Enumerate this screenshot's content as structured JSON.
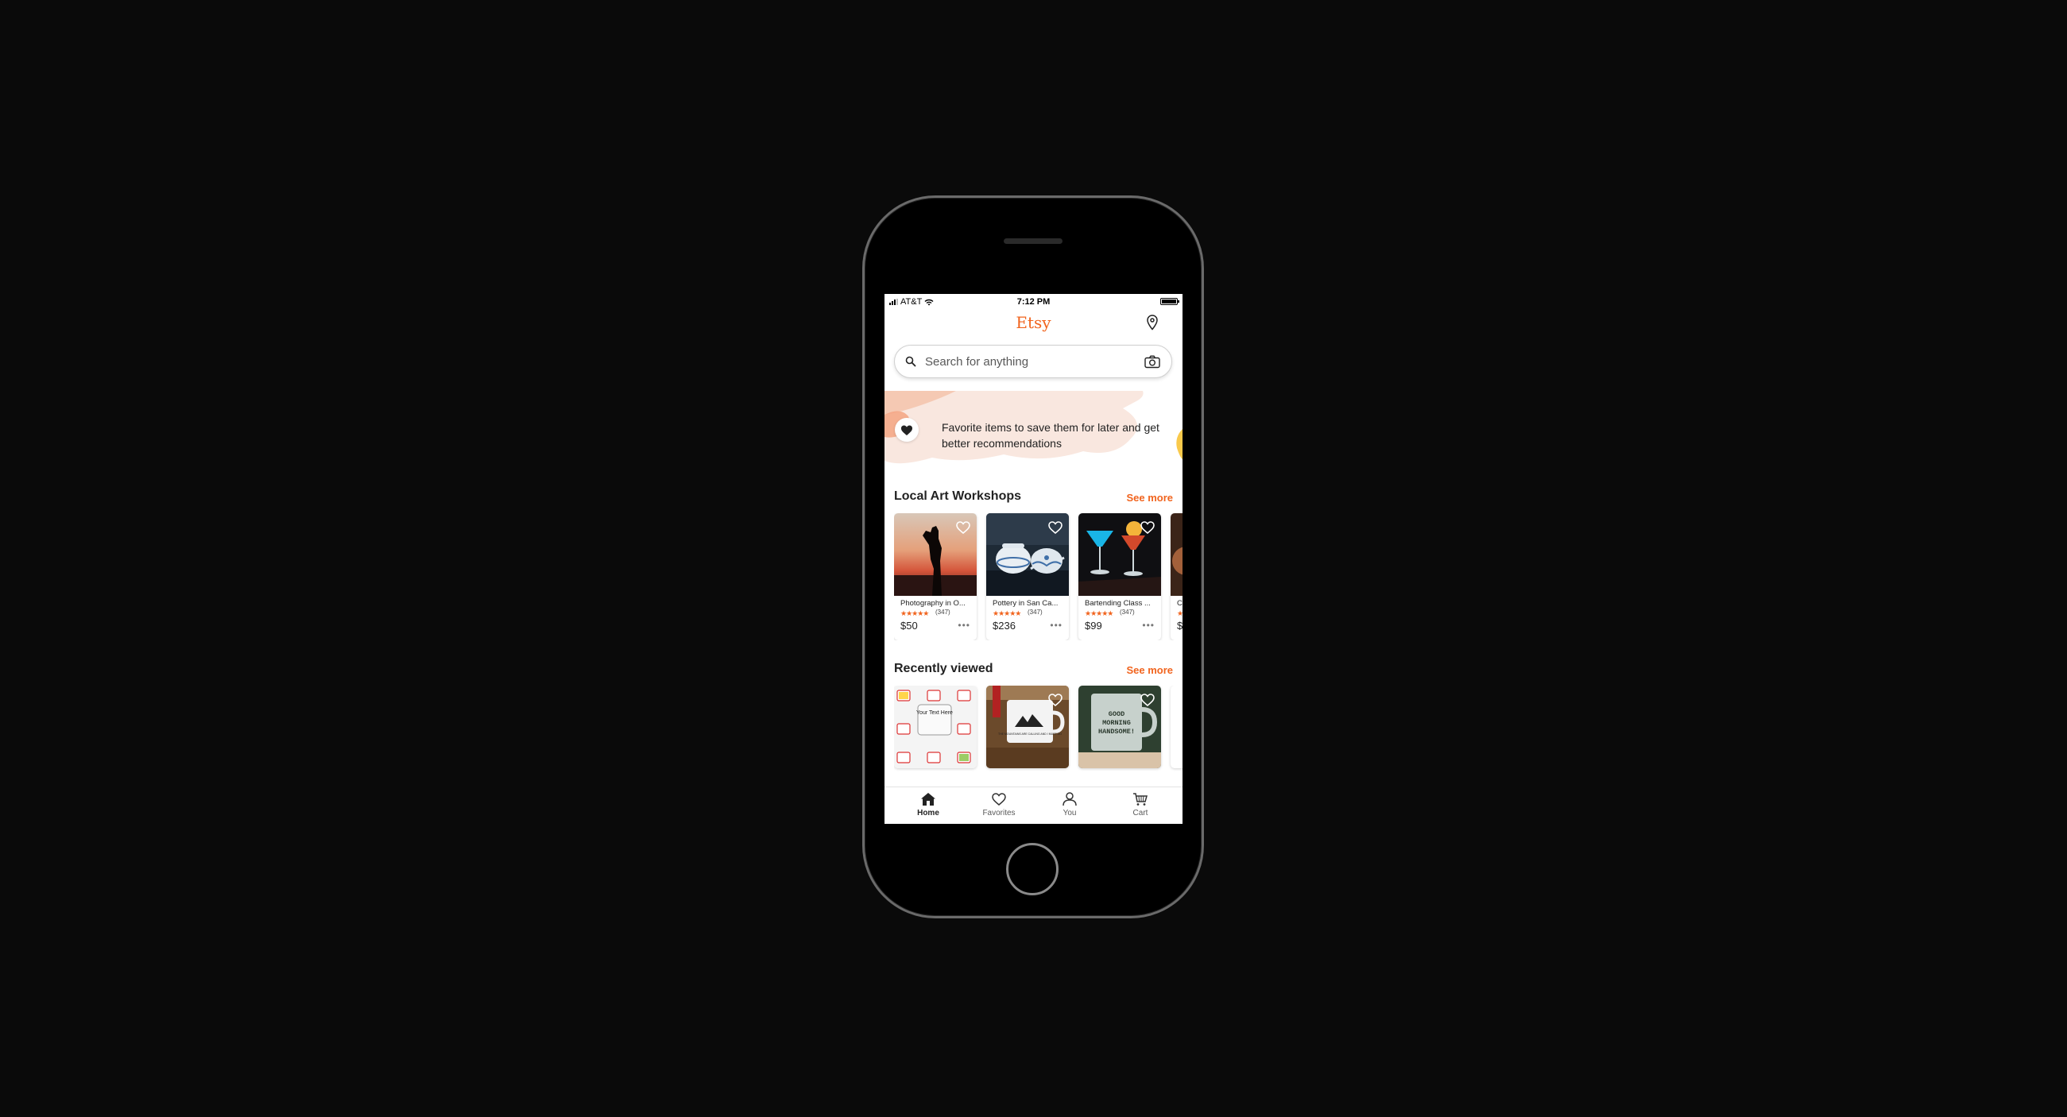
{
  "status_bar": {
    "carrier": "AT&T",
    "time": "7:12 PM"
  },
  "app": {
    "logo": "Etsy"
  },
  "search": {
    "placeholder": "Search for anything"
  },
  "banner": {
    "message": "Favorite items to save them for later and get better recommendations"
  },
  "sections": {
    "workshops": {
      "title": "Local Art Workshops",
      "see_more": "See more",
      "items": [
        {
          "title": "Photography in O...",
          "rating_stars": "★★★★★",
          "reviews": "(347)",
          "price": "$50"
        },
        {
          "title": "Pottery in San Ca...",
          "rating_stars": "★★★★★",
          "reviews": "(347)",
          "price": "$236"
        },
        {
          "title": "Bartending Class ...",
          "rating_stars": "★★★★★",
          "reviews": "(347)",
          "price": "$99"
        },
        {
          "title": "C",
          "rating_stars": "★",
          "reviews": "",
          "price": "$"
        }
      ]
    },
    "recently_viewed": {
      "title": "Recently viewed",
      "see_more": "See more",
      "items": [
        {
          "caption": "Your Text Here"
        },
        {
          "caption": "THE MOUNTAINS ARE CALLING AND I MUST GO"
        },
        {
          "caption": "GOOD MORNING HANDSOME!"
        }
      ]
    }
  },
  "tab_bar": {
    "tabs": [
      {
        "label": "Home",
        "icon": "home-icon",
        "active": true
      },
      {
        "label": "Favorites",
        "icon": "heart-icon",
        "active": false
      },
      {
        "label": "You",
        "icon": "person-icon",
        "active": false
      },
      {
        "label": "Cart",
        "icon": "cart-icon",
        "active": false
      }
    ]
  },
  "colors": {
    "brand": "#f1641e",
    "background": "#0a0a0a",
    "text": "#222222"
  }
}
